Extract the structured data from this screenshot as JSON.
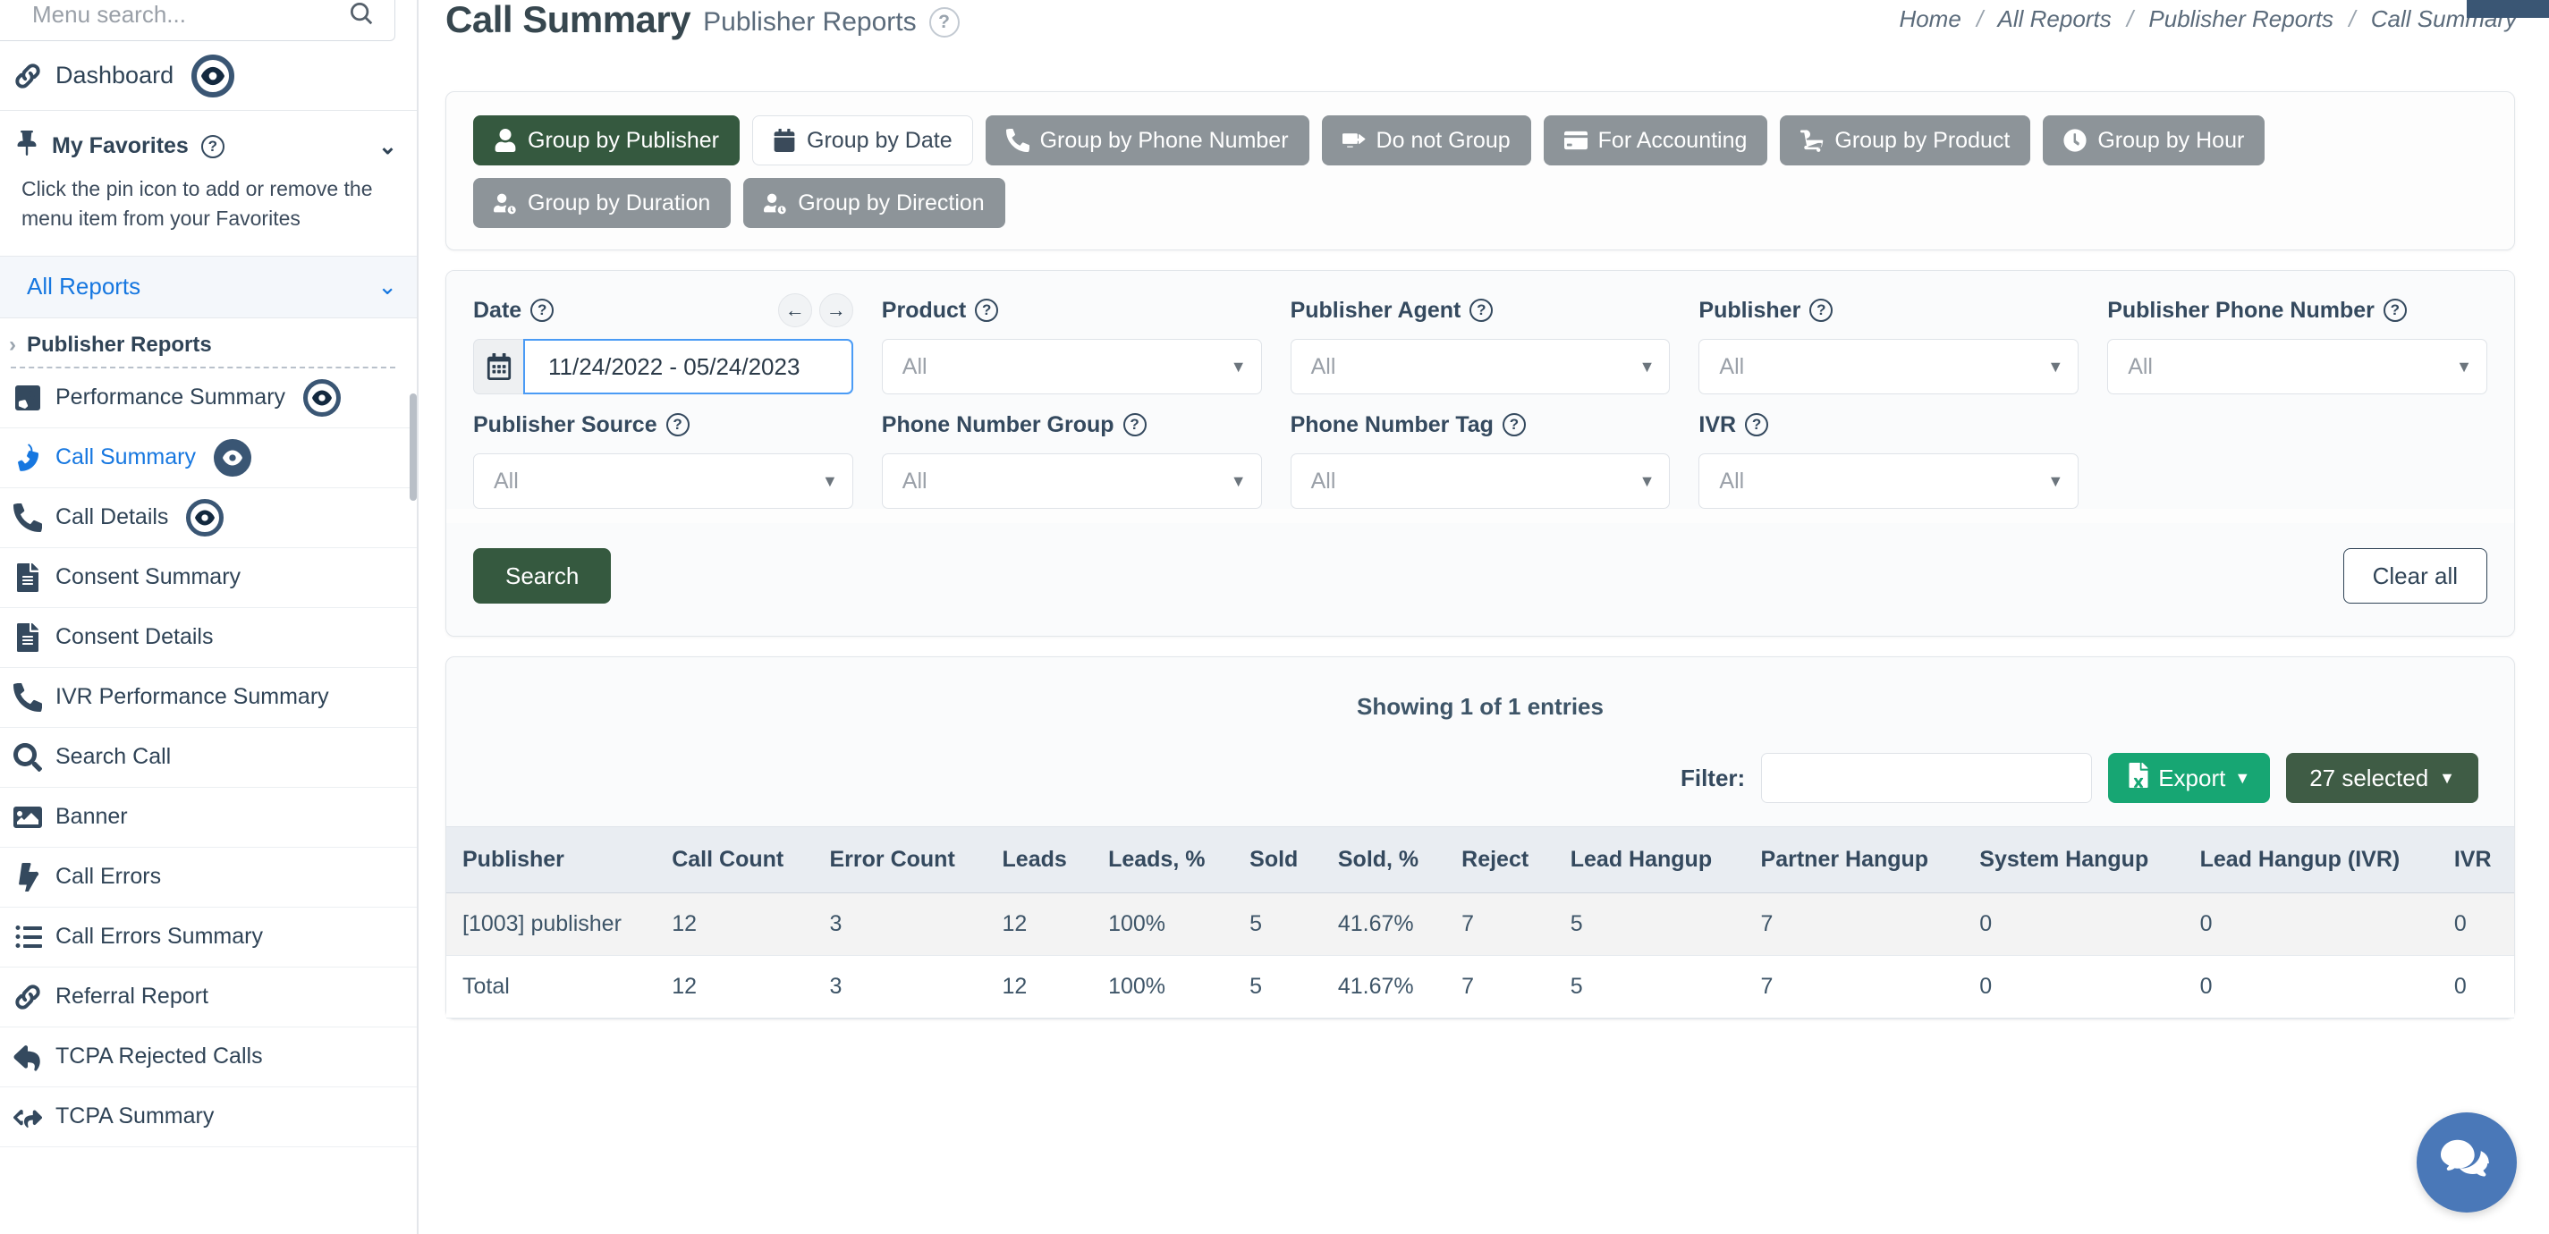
{
  "sidebar": {
    "search_placeholder": "Menu search...",
    "dashboard_label": "Dashboard",
    "favorites": {
      "label": "My Favorites",
      "hint": "Click the pin icon to add or remove the menu item from your Favorites"
    },
    "all_reports_label": "All Reports",
    "section_label": "Publisher Reports",
    "items": [
      {
        "label": "Performance Summary",
        "icon": "phone-square-icon",
        "eye": "outline",
        "active": false
      },
      {
        "label": "Call Summary",
        "icon": "phone-volume-icon",
        "eye": "filled",
        "active": true
      },
      {
        "label": "Call Details",
        "icon": "phone-icon",
        "eye": "outline",
        "active": false
      },
      {
        "label": "Consent Summary",
        "icon": "document-icon",
        "eye": "none",
        "active": false
      },
      {
        "label": "Consent Details",
        "icon": "document-icon",
        "eye": "none",
        "active": false
      },
      {
        "label": "IVR Performance Summary",
        "icon": "phone-icon",
        "eye": "none",
        "active": false
      },
      {
        "label": "Search Call",
        "icon": "search-icon",
        "eye": "none",
        "active": false
      },
      {
        "label": "Banner",
        "icon": "image-icon",
        "eye": "none",
        "active": false
      },
      {
        "label": "Call Errors",
        "icon": "bolt-icon",
        "eye": "none",
        "active": false
      },
      {
        "label": "Call Errors Summary",
        "icon": "list-icon",
        "eye": "none",
        "active": false
      },
      {
        "label": "Referral Report",
        "icon": "link-icon",
        "eye": "none",
        "active": false
      },
      {
        "label": "TCPA Rejected Calls",
        "icon": "reply-icon",
        "eye": "none",
        "active": false
      },
      {
        "label": "TCPA Summary",
        "icon": "reply-all-icon",
        "eye": "none",
        "active": false
      }
    ]
  },
  "header": {
    "title": "Call Summary",
    "subtitle": "Publisher Reports",
    "breadcrumb": [
      "Home",
      "All Reports",
      "Publisher Reports",
      "Call Summary"
    ],
    "breadcrumb_visible_start": "Home",
    "breadcrumb_visible_mid": "All",
    "breadcrumb_visible_end": "ary"
  },
  "group_by": {
    "buttons": [
      {
        "label": "Group by Publisher",
        "icon": "user-icon",
        "state": "active"
      },
      {
        "label": "Group by Date",
        "icon": "calendar-icon",
        "state": "light"
      },
      {
        "label": "Group by Phone Number",
        "icon": "phone-icon",
        "state": "default"
      },
      {
        "label": "Do not Group",
        "icon": "no-group-icon",
        "state": "default"
      },
      {
        "label": "For Accounting",
        "icon": "card-icon",
        "state": "default"
      },
      {
        "label": "Group by Product",
        "icon": "cart-icon",
        "state": "default"
      },
      {
        "label": "Group by Hour",
        "icon": "clock-icon",
        "state": "default"
      },
      {
        "label": "Group by Duration",
        "icon": "user-clock-icon",
        "state": "default"
      },
      {
        "label": "Group by Direction",
        "icon": "user-clock-icon",
        "state": "default"
      }
    ]
  },
  "filters": {
    "date": {
      "label": "Date",
      "value": "11/24/2022 - 05/24/2023"
    },
    "row1": [
      {
        "label": "Product",
        "value": "All"
      },
      {
        "label": "Publisher Agent",
        "value": "All"
      },
      {
        "label": "Publisher",
        "value": "All"
      },
      {
        "label": "Publisher Phone Number",
        "value": "All"
      }
    ],
    "row2": [
      {
        "label": "Publisher Source",
        "value": "All"
      },
      {
        "label": "Phone Number Group",
        "value": "All"
      },
      {
        "label": "Phone Number Tag",
        "value": "All"
      },
      {
        "label": "IVR",
        "value": "All"
      }
    ],
    "search_label": "Search",
    "clear_label": "Clear all"
  },
  "results": {
    "showing": "Showing 1 of 1 entries",
    "filter_label": "Filter:",
    "filter_value": "",
    "export_label": "Export",
    "selected_label": "27 selected"
  },
  "chart_data": {
    "type": "table",
    "title": "Call Summary",
    "columns": [
      "Publisher",
      "Call Count",
      "Error Count",
      "Leads",
      "Leads, %",
      "Sold",
      "Sold, %",
      "Reject",
      "Lead Hangup",
      "Partner Hangup",
      "System Hangup",
      "Lead Hangup (IVR)",
      "IVR"
    ],
    "column_colors": [
      "dark",
      "purple",
      "red",
      "green",
      "dark",
      "blue",
      "dark",
      "red",
      "blue",
      "blue",
      "blue",
      "blue",
      "navy"
    ],
    "rows": [
      {
        "type": "data",
        "values": [
          "[1003] publisher",
          "12",
          "3",
          "12",
          "100%",
          "5",
          "41.67%",
          "7",
          "5",
          "7",
          "0",
          "0",
          "0"
        ]
      },
      {
        "type": "total",
        "values": [
          "Total",
          "12",
          "3",
          "12",
          "100%",
          "5",
          "41.67%",
          "7",
          "5",
          "7",
          "0",
          "0",
          "0"
        ]
      }
    ]
  },
  "colors": {
    "accent_green": "#35593f",
    "export_green": "#17a673",
    "link_blue": "#1677e0",
    "navy": "#3a5674",
    "error_red": "#e8421f",
    "chat_blue": "#4a78b8"
  }
}
